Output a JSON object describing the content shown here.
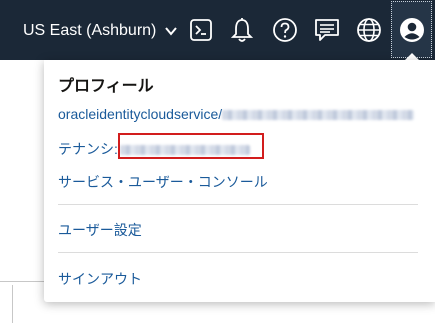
{
  "topbar": {
    "region_label": "US East (Ashburn)",
    "icons": [
      "chevron-down-icon",
      "cloud-shell-icon",
      "bell-icon",
      "help-icon",
      "chat-icon",
      "globe-icon",
      "user-icon"
    ],
    "background": "#1b2837"
  },
  "profile_menu": {
    "title": "プロフィール",
    "identity_prefix": "oracleidentitycloudservice/",
    "tenancy_label": "テナンシ:",
    "console_link": "サービス・ユーザー・コンソール",
    "user_settings": "ユーザー設定",
    "sign_out": "サインアウト",
    "link_color": "#1a5a9a",
    "highlight_color": "#d21d1d"
  }
}
